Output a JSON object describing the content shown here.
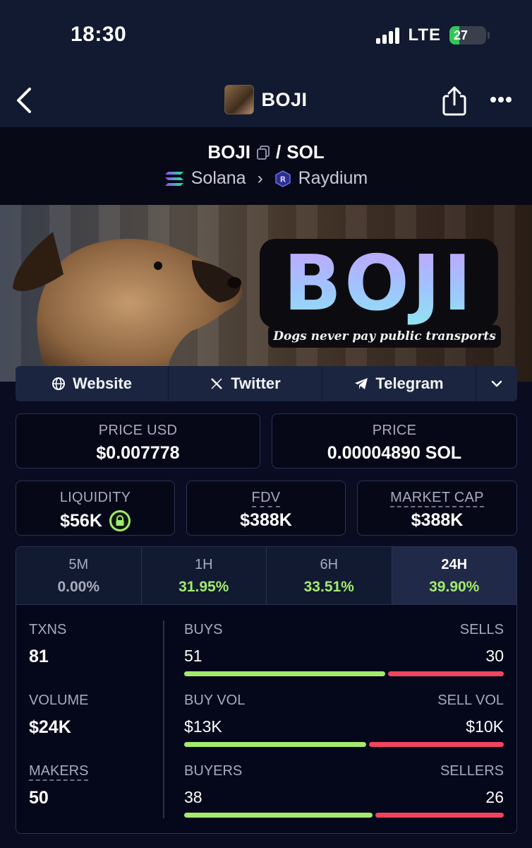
{
  "status_bar": {
    "time": "18:30",
    "network": "LTE",
    "battery_percent": "27",
    "battery_level": 0.27
  },
  "nav": {
    "title": "BOJI",
    "back_icon": "chevron-left-icon",
    "share_icon": "share-icon",
    "more_icon": "more-icon"
  },
  "pair": {
    "base": "BOJI",
    "separator": "/",
    "quote": "SOL",
    "chain": "Solana",
    "dex": "Raydium"
  },
  "banner": {
    "logo_text": "BOJI",
    "tagline": "Dogs never pay public transports"
  },
  "links": [
    {
      "label": "Website",
      "icon": "globe-icon"
    },
    {
      "label": "Twitter",
      "icon": "x-icon"
    },
    {
      "label": "Telegram",
      "icon": "telegram-icon"
    }
  ],
  "price": {
    "usd_label": "PRICE USD",
    "usd_value": "$0.007778",
    "native_label": "PRICE",
    "native_value": "0.00004890 SOL"
  },
  "metrics": {
    "liquidity_label": "LIQUIDITY",
    "liquidity_value": "$56K",
    "fdv_label": "FDV",
    "fdv_value": "$388K",
    "mcap_label": "MARKET CAP",
    "mcap_value": "$388K"
  },
  "timeframes": [
    {
      "label": "5M",
      "value": "0.00%",
      "trend": "neutral"
    },
    {
      "label": "1H",
      "value": "31.95%",
      "trend": "up"
    },
    {
      "label": "6H",
      "value": "33.51%",
      "trend": "up"
    },
    {
      "label": "24H",
      "value": "39.90%",
      "trend": "up",
      "active": true
    }
  ],
  "stats": {
    "txns_label": "TXNS",
    "txns_value": "81",
    "volume_label": "VOLUME",
    "volume_value": "$24K",
    "makers_label": "MAKERS",
    "makers_value": "50",
    "buys_label": "BUYS",
    "buys_value": "51",
    "sells_label": "SELLS",
    "sells_value": "30",
    "buys_ratio": 0.63,
    "buyvol_label": "BUY VOL",
    "buyvol_value": "$13K",
    "sellvol_label": "SELL VOL",
    "sellvol_value": "$10K",
    "buyvol_ratio": 0.57,
    "buyers_label": "BUYERS",
    "buyers_value": "38",
    "sellers_label": "SELLERS",
    "sellers_value": "26",
    "buyers_ratio": 0.59
  },
  "colors": {
    "up": "#a3ea6d",
    "down": "#f2445e",
    "background": "#0a0c22"
  }
}
